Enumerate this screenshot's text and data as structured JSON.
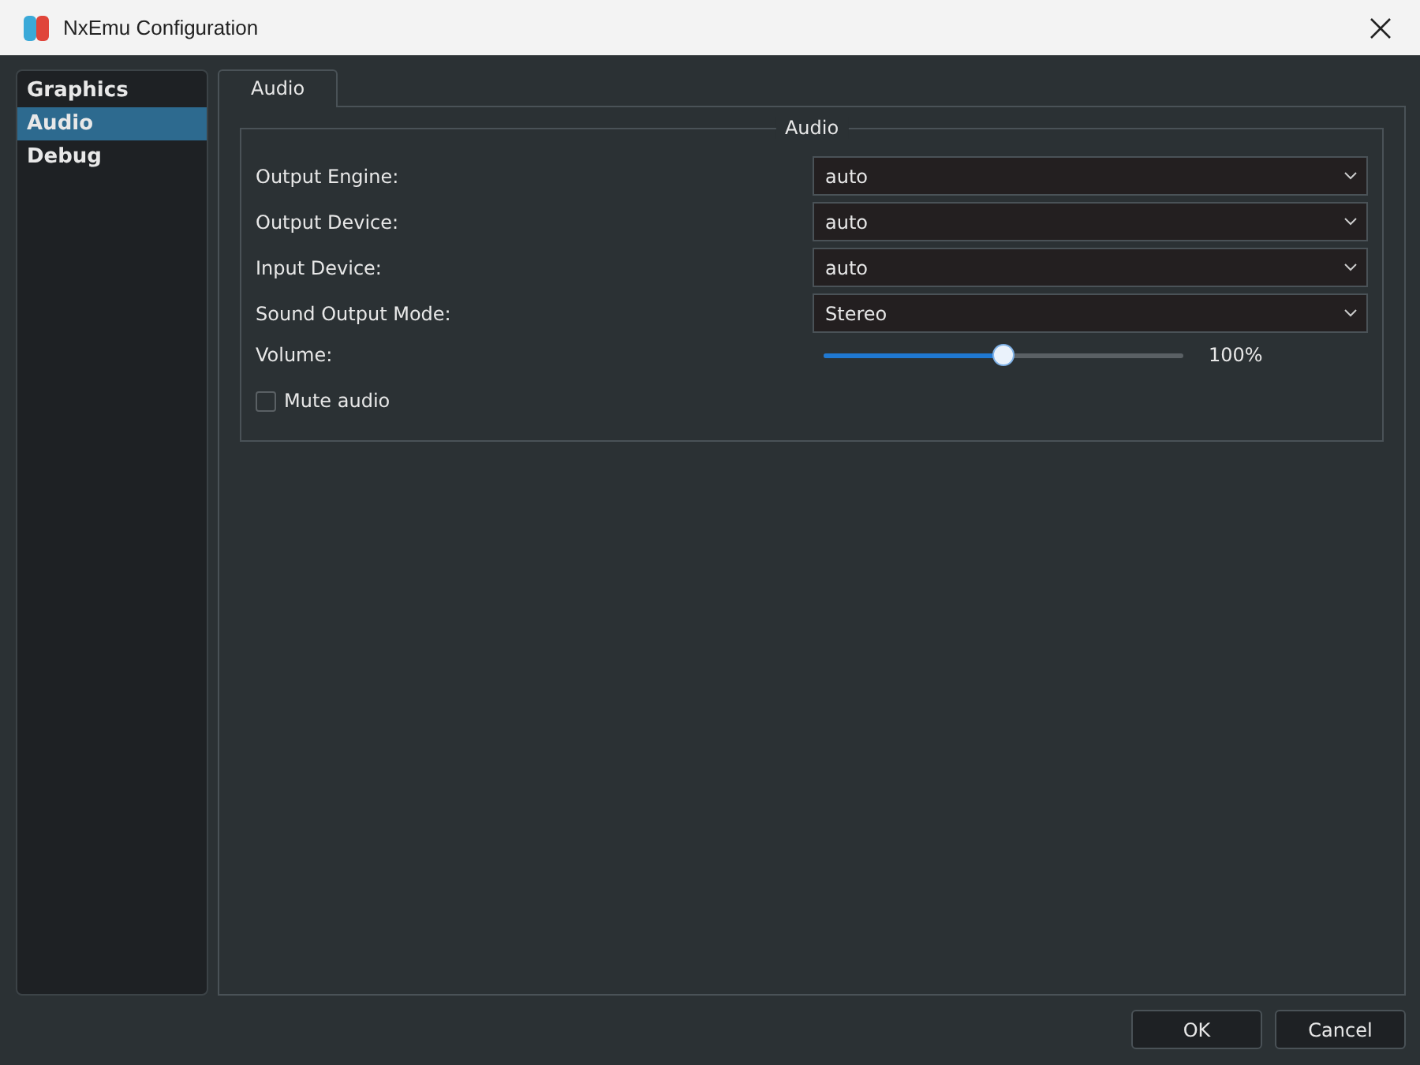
{
  "window": {
    "title": "NxEmu Configuration"
  },
  "sidebar": {
    "items": [
      {
        "label": "Graphics",
        "selected": false
      },
      {
        "label": "Audio",
        "selected": true
      },
      {
        "label": "Debug",
        "selected": false
      }
    ]
  },
  "tabs": [
    {
      "label": "Audio",
      "selected": true
    }
  ],
  "group": {
    "title": "Audio",
    "rows": [
      {
        "kind": "combo",
        "label": "Output Engine:",
        "value": "auto"
      },
      {
        "kind": "combo",
        "label": "Output Device:",
        "value": "auto"
      },
      {
        "kind": "combo",
        "label": "Input Device:",
        "value": "auto"
      },
      {
        "kind": "combo",
        "label": "Sound Output Mode:",
        "value": "Stereo"
      },
      {
        "kind": "slider",
        "label": "Volume:",
        "level": 0.5,
        "reading": "100%"
      },
      {
        "kind": "checkbox",
        "label": "Mute audio",
        "checked": false
      }
    ]
  },
  "buttons": [
    "OK",
    "Cancel"
  ]
}
